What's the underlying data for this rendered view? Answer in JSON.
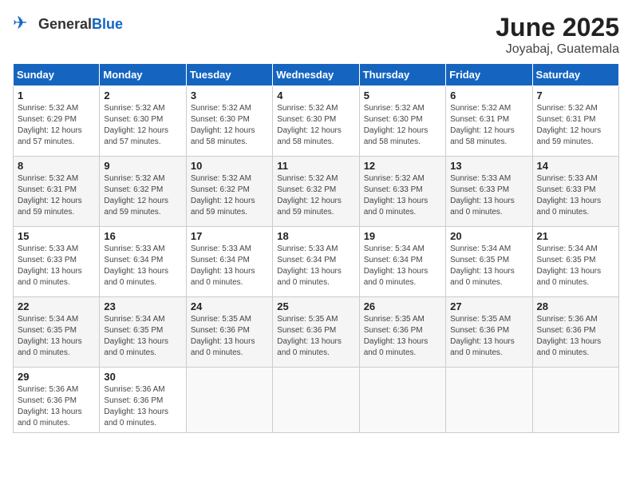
{
  "header": {
    "logo_general": "General",
    "logo_blue": "Blue",
    "month_year": "June 2025",
    "location": "Joyabaj, Guatemala"
  },
  "weekdays": [
    "Sunday",
    "Monday",
    "Tuesday",
    "Wednesday",
    "Thursday",
    "Friday",
    "Saturday"
  ],
  "weeks": [
    [
      {
        "day": "1",
        "sunrise": "5:32 AM",
        "sunset": "6:29 PM",
        "daylight": "12 hours and 57 minutes."
      },
      {
        "day": "2",
        "sunrise": "5:32 AM",
        "sunset": "6:30 PM",
        "daylight": "12 hours and 57 minutes."
      },
      {
        "day": "3",
        "sunrise": "5:32 AM",
        "sunset": "6:30 PM",
        "daylight": "12 hours and 58 minutes."
      },
      {
        "day": "4",
        "sunrise": "5:32 AM",
        "sunset": "6:30 PM",
        "daylight": "12 hours and 58 minutes."
      },
      {
        "day": "5",
        "sunrise": "5:32 AM",
        "sunset": "6:30 PM",
        "daylight": "12 hours and 58 minutes."
      },
      {
        "day": "6",
        "sunrise": "5:32 AM",
        "sunset": "6:31 PM",
        "daylight": "12 hours and 58 minutes."
      },
      {
        "day": "7",
        "sunrise": "5:32 AM",
        "sunset": "6:31 PM",
        "daylight": "12 hours and 59 minutes."
      }
    ],
    [
      {
        "day": "8",
        "sunrise": "5:32 AM",
        "sunset": "6:31 PM",
        "daylight": "12 hours and 59 minutes."
      },
      {
        "day": "9",
        "sunrise": "5:32 AM",
        "sunset": "6:32 PM",
        "daylight": "12 hours and 59 minutes."
      },
      {
        "day": "10",
        "sunrise": "5:32 AM",
        "sunset": "6:32 PM",
        "daylight": "12 hours and 59 minutes."
      },
      {
        "day": "11",
        "sunrise": "5:32 AM",
        "sunset": "6:32 PM",
        "daylight": "12 hours and 59 minutes."
      },
      {
        "day": "12",
        "sunrise": "5:32 AM",
        "sunset": "6:33 PM",
        "daylight": "13 hours and 0 minutes."
      },
      {
        "day": "13",
        "sunrise": "5:33 AM",
        "sunset": "6:33 PM",
        "daylight": "13 hours and 0 minutes."
      },
      {
        "day": "14",
        "sunrise": "5:33 AM",
        "sunset": "6:33 PM",
        "daylight": "13 hours and 0 minutes."
      }
    ],
    [
      {
        "day": "15",
        "sunrise": "5:33 AM",
        "sunset": "6:33 PM",
        "daylight": "13 hours and 0 minutes."
      },
      {
        "day": "16",
        "sunrise": "5:33 AM",
        "sunset": "6:34 PM",
        "daylight": "13 hours and 0 minutes."
      },
      {
        "day": "17",
        "sunrise": "5:33 AM",
        "sunset": "6:34 PM",
        "daylight": "13 hours and 0 minutes."
      },
      {
        "day": "18",
        "sunrise": "5:33 AM",
        "sunset": "6:34 PM",
        "daylight": "13 hours and 0 minutes."
      },
      {
        "day": "19",
        "sunrise": "5:34 AM",
        "sunset": "6:34 PM",
        "daylight": "13 hours and 0 minutes."
      },
      {
        "day": "20",
        "sunrise": "5:34 AM",
        "sunset": "6:35 PM",
        "daylight": "13 hours and 0 minutes."
      },
      {
        "day": "21",
        "sunrise": "5:34 AM",
        "sunset": "6:35 PM",
        "daylight": "13 hours and 0 minutes."
      }
    ],
    [
      {
        "day": "22",
        "sunrise": "5:34 AM",
        "sunset": "6:35 PM",
        "daylight": "13 hours and 0 minutes."
      },
      {
        "day": "23",
        "sunrise": "5:34 AM",
        "sunset": "6:35 PM",
        "daylight": "13 hours and 0 minutes."
      },
      {
        "day": "24",
        "sunrise": "5:35 AM",
        "sunset": "6:36 PM",
        "daylight": "13 hours and 0 minutes."
      },
      {
        "day": "25",
        "sunrise": "5:35 AM",
        "sunset": "6:36 PM",
        "daylight": "13 hours and 0 minutes."
      },
      {
        "day": "26",
        "sunrise": "5:35 AM",
        "sunset": "6:36 PM",
        "daylight": "13 hours and 0 minutes."
      },
      {
        "day": "27",
        "sunrise": "5:35 AM",
        "sunset": "6:36 PM",
        "daylight": "13 hours and 0 minutes."
      },
      {
        "day": "28",
        "sunrise": "5:36 AM",
        "sunset": "6:36 PM",
        "daylight": "13 hours and 0 minutes."
      }
    ],
    [
      {
        "day": "29",
        "sunrise": "5:36 AM",
        "sunset": "6:36 PM",
        "daylight": "13 hours and 0 minutes."
      },
      {
        "day": "30",
        "sunrise": "5:36 AM",
        "sunset": "6:36 PM",
        "daylight": "13 hours and 0 minutes."
      },
      null,
      null,
      null,
      null,
      null
    ]
  ]
}
